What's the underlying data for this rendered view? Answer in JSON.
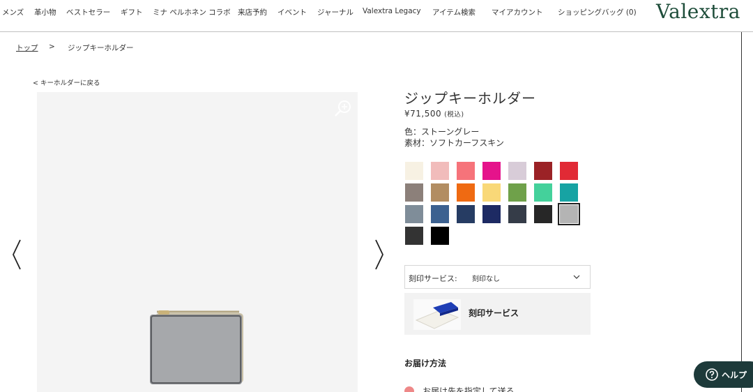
{
  "nav": {
    "items": [
      "メンズ",
      "革小物",
      "ベストセラー",
      "ギフト",
      "ミナ ペルホネン コラボ",
      "来店予約",
      "イベント",
      "ジャーナル",
      "Valextra Legacy",
      "アイテム検索",
      "マイアカウント",
      "ショッピングバッグ (0)"
    ]
  },
  "logo": "Valextra",
  "breadcrumb": {
    "top": "トップ",
    "sep": ">",
    "current": "ジップキーホルダー"
  },
  "back_link": "< キーホルダーに戻る",
  "product": {
    "title": "ジップキーホルダー",
    "price": "¥71,500",
    "tax_note": "(税込)",
    "color": "色：ストーングレー",
    "material": "素材：ソフトカーフスキン"
  },
  "swatches": [
    {
      "color": "#f7f1e3"
    },
    {
      "color": "#f1bcbb"
    },
    {
      "color": "#f6737a"
    },
    {
      "color": "#e5138b"
    },
    {
      "color": "#d8ccd8"
    },
    {
      "color": "#9b2226"
    },
    {
      "color": "#e12a35"
    },
    {
      "color": "#8c807a"
    },
    {
      "color": "#b28d62"
    },
    {
      "color": "#ef6a12"
    },
    {
      "color": "#f9d878"
    },
    {
      "color": "#6fa14a"
    },
    {
      "color": "#44d19b"
    },
    {
      "color": "#17a3a3"
    },
    {
      "color": "#7f8d99"
    },
    {
      "color": "#3c6190"
    },
    {
      "color": "#263c63"
    },
    {
      "color": "#1d2a63"
    },
    {
      "color": "#353c48"
    },
    {
      "color": "#272727"
    },
    {
      "color": "#b4b4b4",
      "selected": true
    },
    {
      "color": "#333333"
    },
    {
      "color": "#000000"
    }
  ],
  "engraving": {
    "label": "刻印サービス:",
    "value": "刻印なし",
    "panel_text": "刻印サービス"
  },
  "delivery": {
    "title": "お届け方法",
    "option": "お届け先を指定して送る"
  },
  "help": {
    "label": "ヘルプ"
  },
  "icons": [
    "zoom-icon",
    "chevron-left-icon",
    "chevron-right-icon",
    "chevron-down-icon",
    "help-icon"
  ]
}
